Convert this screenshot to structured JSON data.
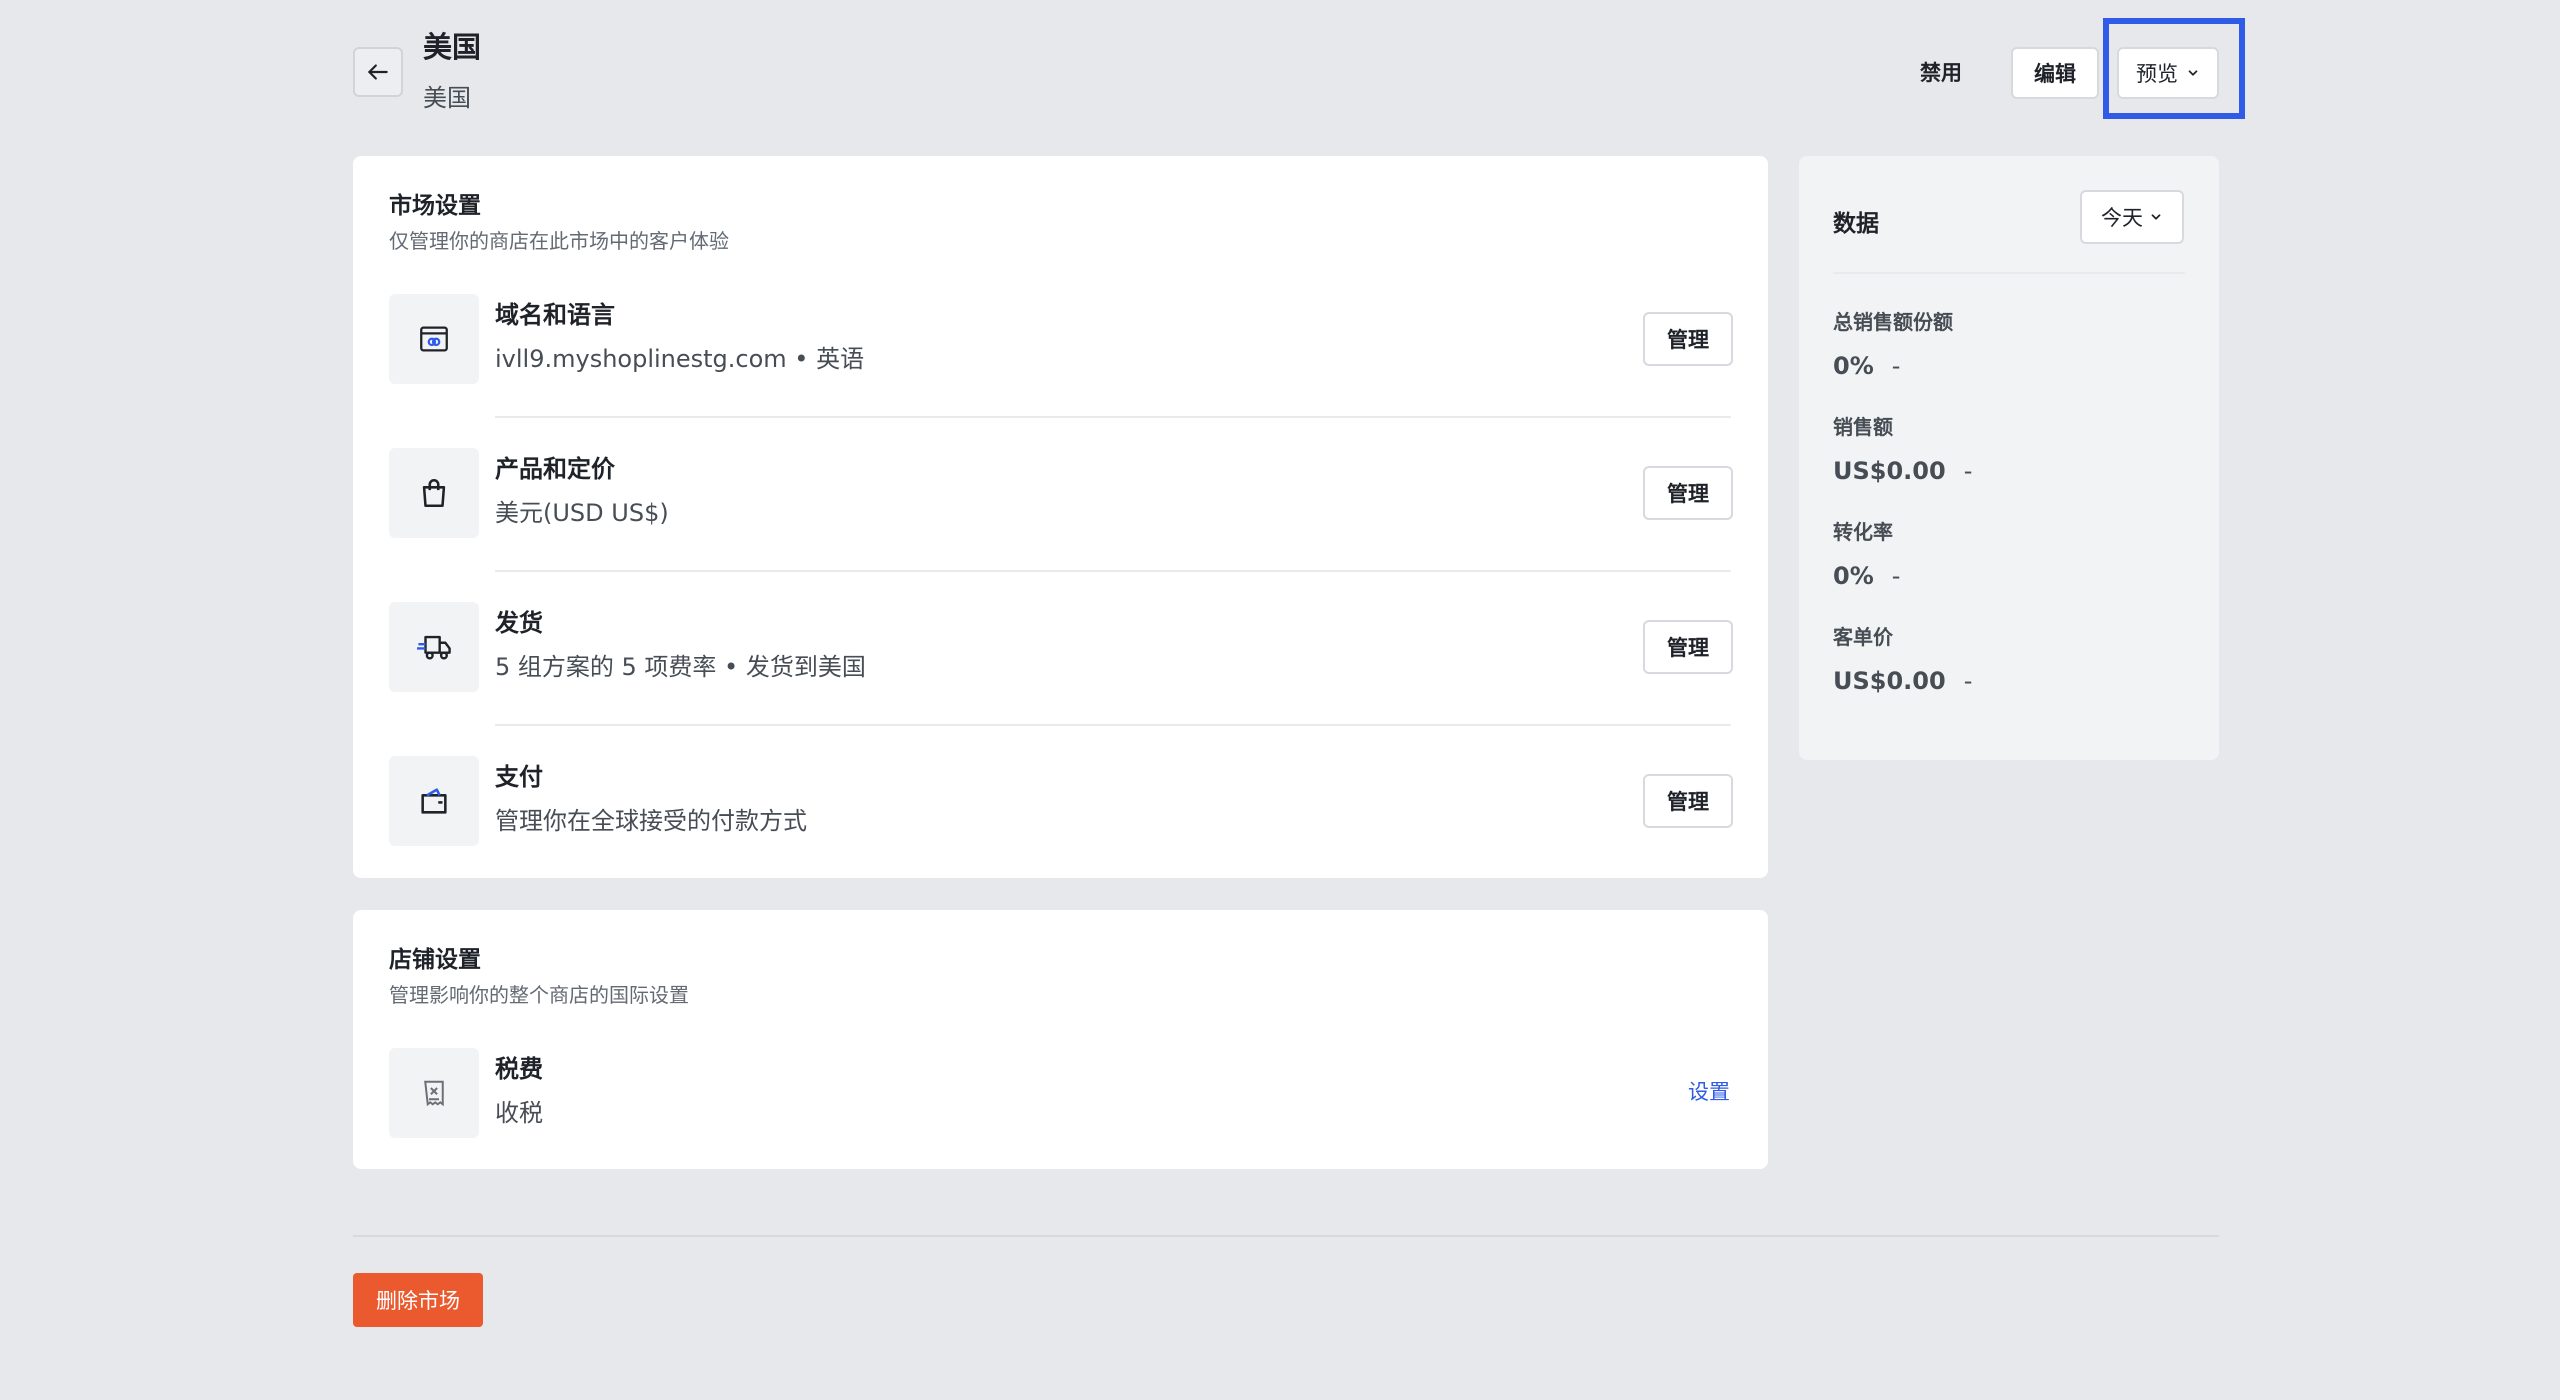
{
  "header": {
    "title": "美国",
    "subtitle": "美国",
    "disable_label": "禁用",
    "edit_label": "编辑",
    "preview_label": "预览"
  },
  "market_settings": {
    "title": "市场设置",
    "description": "仅管理你的商店在此市场中的客户体验",
    "rows": [
      {
        "icon": "domain-icon",
        "title": "域名和语言",
        "description": "ivll9.myshoplinestg.com • 英语",
        "button": "管理"
      },
      {
        "icon": "shopping-bag-icon",
        "title": "产品和定价",
        "description": "美元(USD US$)",
        "button": "管理"
      },
      {
        "icon": "delivery-truck-icon",
        "title": "发货",
        "description": "5 组方案的 5 项费率 • 发货到美国",
        "button": "管理"
      },
      {
        "icon": "wallet-icon",
        "title": "支付",
        "description": "管理你在全球接受的付款方式",
        "button": "管理"
      }
    ]
  },
  "store_settings": {
    "title": "店铺设置",
    "description": "管理影响你的整个商店的国际设置",
    "rows": [
      {
        "icon": "tax-receipt-icon",
        "title": "税费",
        "description": "收税",
        "link": "设置"
      }
    ]
  },
  "data_panel": {
    "title": "数据",
    "range_label": "今天",
    "metrics": [
      {
        "label": "总销售额份额",
        "value": "0%",
        "change": "-"
      },
      {
        "label": "销售额",
        "value": "US$0.00",
        "change": "-"
      },
      {
        "label": "转化率",
        "value": "0%",
        "change": "-"
      },
      {
        "label": "客单价",
        "value": "US$0.00",
        "change": "-"
      }
    ]
  },
  "footer": {
    "delete_label": "删除市场"
  },
  "colors": {
    "accent": "#2f5be7",
    "danger": "#ea5a2e",
    "background": "#e6e8ec"
  }
}
